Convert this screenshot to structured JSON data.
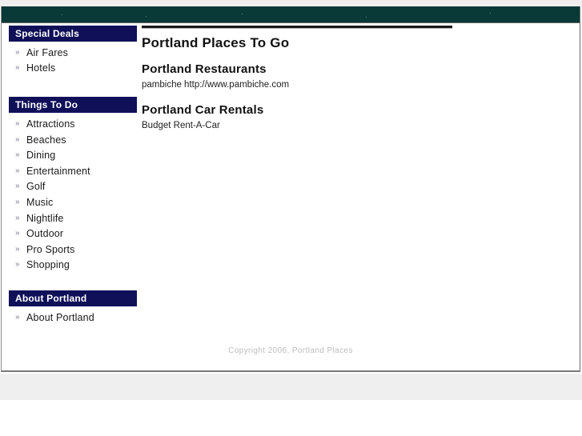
{
  "theme": {
    "masthead_color": "#0a3a37",
    "nav_heading_color": "#0f1058",
    "page_background": "#ffffff",
    "outer_background": "#efefef",
    "footer_text_color": "#bdbdbd",
    "bullet_glyph": "»"
  },
  "sidebar": {
    "blocks": [
      {
        "heading": "Special Deals",
        "items": [
          {
            "label": "Air Fares"
          },
          {
            "label": "Hotels"
          }
        ]
      },
      {
        "heading": "Things To Do",
        "items": [
          {
            "label": "Attractions"
          },
          {
            "label": "Beaches"
          },
          {
            "label": "Dining"
          },
          {
            "label": "Entertainment"
          },
          {
            "label": "Golf"
          },
          {
            "label": "Music"
          },
          {
            "label": "Nightlife"
          },
          {
            "label": "Outdoor"
          },
          {
            "label": "Pro Sports"
          },
          {
            "label": "Shopping"
          }
        ]
      },
      {
        "heading": "About Portland",
        "items": [
          {
            "label": "About Portland"
          }
        ]
      }
    ]
  },
  "main": {
    "title": "Portland Places To Go",
    "sections": [
      {
        "heading": "Portland Restaurants",
        "entries": [
          {
            "text": "pambiche http://www.pambiche.com"
          }
        ]
      },
      {
        "heading": "Portland Car Rentals",
        "entries": [
          {
            "text": "Budget Rent-A-Car"
          }
        ]
      }
    ]
  },
  "footer": {
    "copyright": "Copyright 2006, Portland Places"
  }
}
